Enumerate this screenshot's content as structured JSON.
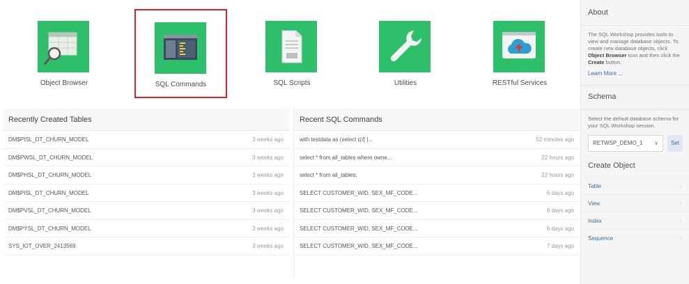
{
  "tiles": [
    {
      "label": "Object Browser",
      "icon": "object-browser-icon"
    },
    {
      "label": "SQL Commands",
      "icon": "sql-commands-icon"
    },
    {
      "label": "SQL Scripts",
      "icon": "sql-scripts-icon"
    },
    {
      "label": "Utilities",
      "icon": "wrench-icon"
    },
    {
      "label": "RESTful Services",
      "icon": "cloud-upload-icon"
    }
  ],
  "recent_tables": {
    "title": "Recently Created Tables",
    "rows": [
      {
        "name": "DM$PISL_DT_CHURN_MODEL",
        "time": "3 weeks ago"
      },
      {
        "name": "DM$PWSL_DT_CHURN_MODEL",
        "time": "3 weeks ago"
      },
      {
        "name": "DM$PHSL_DT_CHURN_MODEL",
        "time": "3 weeks ago"
      },
      {
        "name": "DM$PISL_DT_CHURN_MODEL",
        "time": "3 weeks ago"
      },
      {
        "name": "DM$PVSL_DT_CHURN_MODEL",
        "time": "3 weeks ago"
      },
      {
        "name": "DM$PYSL_DT_CHURN_MODEL",
        "time": "3 weeks ago"
      },
      {
        "name": "SYS_IOT_OVER_2413569",
        "time": "3 weeks ago"
      }
    ]
  },
  "recent_sql": {
    "title": "Recent SQL Commands",
    "rows": [
      {
        "name": "with testdata as (select q'/[ |...",
        "time": "52 minutes ago"
      },
      {
        "name": "select * from all_tables where owne...",
        "time": "22 hours ago"
      },
      {
        "name": "select * from all_tables;",
        "time": "22 hours ago"
      },
      {
        "name": "SELECT CUSTOMER_WID, SEX_MF_CODE...",
        "time": "6 days ago"
      },
      {
        "name": "SELECT CUSTOMER_WID, SEX_MF_CODE...",
        "time": "6 days ago"
      },
      {
        "name": "SELECT CUSTOMER_WID, SEX_MF_CODE...",
        "time": "6 days ago"
      },
      {
        "name": "SELECT CUSTOMER_WID, SEX_MF_CODE...",
        "time": "7 days ago"
      }
    ]
  },
  "sidebar": {
    "about_title": "About",
    "about_text_1": "The SQL Workshop provides tools to view and manage database objects. To create new database objects, click ",
    "about_bold_1": "Object Browser",
    "about_text_2": " icon and then click the ",
    "about_bold_2": "Create",
    "about_text_3": " button.",
    "learn_more": "Learn More ...",
    "schema_title": "Schema",
    "schema_text": "Select the default database schema for your SQL Workshop session.",
    "schema_value": "RETWSP_DEMO_1",
    "set_label": "Set",
    "create_title": "Create Object",
    "create_items": [
      "Table",
      "View",
      "Index",
      "Sequence"
    ]
  },
  "colors": {
    "tile_green": "#2ebf6a",
    "selection_red": "#e0202a",
    "link_blue": "#2f6ea6"
  }
}
